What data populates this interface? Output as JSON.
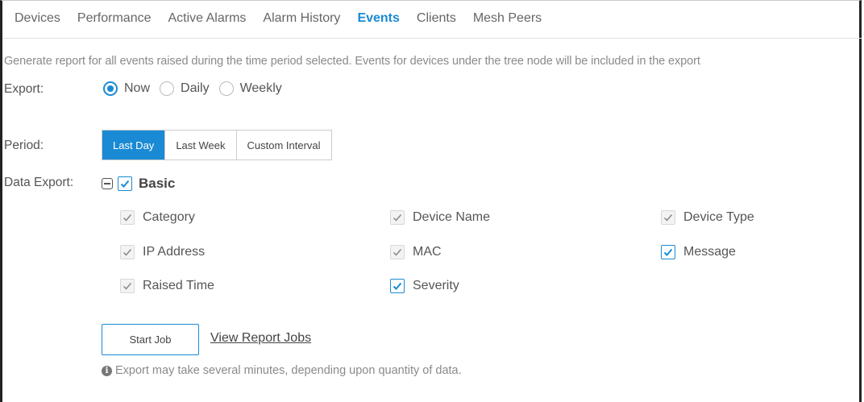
{
  "tabs": [
    {
      "label": "Devices"
    },
    {
      "label": "Performance"
    },
    {
      "label": "Active Alarms"
    },
    {
      "label": "Alarm History"
    },
    {
      "label": "Events",
      "active": true
    },
    {
      "label": "Clients"
    },
    {
      "label": "Mesh Peers"
    }
  ],
  "description": "Generate report for all events raised during the time period selected. Events for devices under the tree node will be included in the export",
  "export": {
    "label": "Export:",
    "options": [
      {
        "label": "Now",
        "selected": true
      },
      {
        "label": "Daily",
        "selected": false
      },
      {
        "label": "Weekly",
        "selected": false
      }
    ]
  },
  "period": {
    "label": "Period:",
    "options": [
      {
        "label": "Last Day",
        "active": true
      },
      {
        "label": "Last Week",
        "active": false
      },
      {
        "label": "Custom Interval",
        "active": false
      }
    ]
  },
  "data_export": {
    "label": "Data Export:",
    "group_label": "Basic",
    "fields": [
      {
        "label": "Category",
        "checked": true,
        "editable": false
      },
      {
        "label": "Device Name",
        "checked": true,
        "editable": false
      },
      {
        "label": "Device Type",
        "checked": true,
        "editable": false
      },
      {
        "label": "IP Address",
        "checked": true,
        "editable": false
      },
      {
        "label": "MAC",
        "checked": true,
        "editable": false
      },
      {
        "label": "Message",
        "checked": true,
        "editable": true
      },
      {
        "label": "Raised Time",
        "checked": true,
        "editable": false
      },
      {
        "label": "Severity",
        "checked": true,
        "editable": true
      }
    ]
  },
  "actions": {
    "start_job": "Start Job",
    "view_report_jobs": "View Report Jobs"
  },
  "note": "Export may take several minutes, depending upon quantity of data.",
  "icons": {
    "info": "info-icon",
    "collapse": "minus-square-icon",
    "check": "check-icon"
  },
  "colors": {
    "accent": "#1a8ad4",
    "text": "#555555",
    "muted": "#8a8a8a"
  }
}
